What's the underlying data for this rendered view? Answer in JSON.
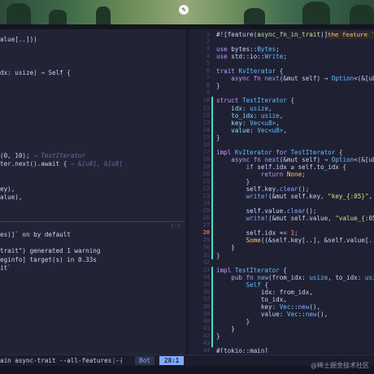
{
  "window": {
    "edit_icon": "pencil-icon"
  },
  "left_pane": {
    "code_lines": [
      {
        "text": "alue[..]))",
        "class": "v"
      },
      {
        "text": "",
        "class": "v"
      },
      {
        "text": "",
        "class": "v"
      },
      {
        "text": "",
        "class": "v"
      },
      {
        "text": "dx: usize) → Self {",
        "class": "v"
      },
      {
        "text": "",
        "class": "v"
      },
      {
        "text": "",
        "class": "v"
      },
      {
        "text": "",
        "class": "v"
      },
      {
        "text": "",
        "class": "v"
      },
      {
        "text": "",
        "class": "v"
      },
      {
        "text": "",
        "class": "v"
      },
      {
        "text": "",
        "class": "v"
      },
      {
        "text": "",
        "class": "v"
      },
      {
        "text": "",
        "class": "v"
      },
      {
        "text": "(0, 10); ",
        "class": "v",
        "hint": "⇒ TestIterator"
      },
      {
        "text": "ter.next().await { ",
        "class": "v",
        "hint": "⇒ &[u8], &[u8]"
      },
      {
        "text": "",
        "class": "v"
      },
      {
        "text": "",
        "class": "v"
      },
      {
        "text": "ey),",
        "class": "v"
      },
      {
        "text": "alue),",
        "class": "v"
      }
    ],
    "terminal_lines": [
      "es)]` on by default",
      "",
      "trait\") generated 1 warning",
      "eginfo] target(s) in 0.33s",
      "it`"
    ],
    "terminal_position": "5:5"
  },
  "right_pane": {
    "inline_hint": "the feature `a",
    "lines": [
      {
        "n": "1",
        "segs": [
          [
            "#![feature(",
            "v"
          ],
          [
            "async_fn_in_trait",
            "s"
          ],
          [
            ")]",
            "v"
          ]
        ]
      },
      {
        "n": "2",
        "segs": []
      },
      {
        "n": "3",
        "segs": [
          [
            "use ",
            "k"
          ],
          [
            "bytes::",
            "v"
          ],
          [
            "Bytes",
            "t"
          ],
          [
            ";",
            "v"
          ]
        ]
      },
      {
        "n": "4",
        "segs": [
          [
            "use ",
            "k"
          ],
          [
            "std::io::",
            "v"
          ],
          [
            "Write",
            "t"
          ],
          [
            ";",
            "v"
          ]
        ]
      },
      {
        "n": "5",
        "segs": []
      },
      {
        "n": "6",
        "segs": [
          [
            "trait ",
            "k"
          ],
          [
            "KvIterator",
            "t"
          ],
          [
            " {",
            "v"
          ]
        ]
      },
      {
        "n": "7",
        "segs": [
          [
            "    async fn ",
            "k"
          ],
          [
            "next",
            "f"
          ],
          [
            "(&mut self) → ",
            "v"
          ],
          [
            "Option",
            "t"
          ],
          [
            "<(&[u8], &[u8",
            "v"
          ]
        ]
      },
      {
        "n": "8",
        "segs": [
          [
            "}",
            "v"
          ]
        ]
      },
      {
        "n": "9",
        "segs": []
      },
      {
        "n": "10",
        "segs": [
          [
            "struct ",
            "k"
          ],
          [
            "TestIterator",
            "t"
          ],
          [
            " {",
            "v"
          ]
        ]
      },
      {
        "n": "11",
        "segs": [
          [
            "    idx",
            "p"
          ],
          [
            ": ",
            "v"
          ],
          [
            "usize",
            "t"
          ],
          [
            ",",
            "v"
          ]
        ]
      },
      {
        "n": "12",
        "segs": [
          [
            "    to_idx",
            "p"
          ],
          [
            ": ",
            "v"
          ],
          [
            "usize",
            "t"
          ],
          [
            ",",
            "v"
          ]
        ]
      },
      {
        "n": "13",
        "segs": [
          [
            "    key",
            "p"
          ],
          [
            ": ",
            "v"
          ],
          [
            "Vec<u8>",
            "t"
          ],
          [
            ",",
            "v"
          ]
        ]
      },
      {
        "n": "14",
        "segs": [
          [
            "    value",
            "p"
          ],
          [
            ": ",
            "v"
          ],
          [
            "Vec<u8>",
            "t"
          ],
          [
            ",",
            "v"
          ]
        ]
      },
      {
        "n": "15",
        "segs": [
          [
            "}",
            "v"
          ]
        ]
      },
      {
        "n": "16",
        "segs": []
      },
      {
        "n": "17",
        "segs": [
          [
            "impl ",
            "k"
          ],
          [
            "KvIterator",
            "t"
          ],
          [
            " for ",
            "k"
          ],
          [
            "TestIterator",
            "t"
          ],
          [
            " {",
            "v"
          ]
        ]
      },
      {
        "n": "18",
        "segs": [
          [
            "    async fn ",
            "k"
          ],
          [
            "next",
            "f"
          ],
          [
            "(&mut self) → ",
            "v"
          ],
          [
            "Option",
            "t"
          ],
          [
            "<(&[u8], &[u8",
            "v"
          ]
        ]
      },
      {
        "n": "19",
        "segs": [
          [
            "        if ",
            "k"
          ],
          [
            "self.idx ≥ self.to_idx {",
            "v"
          ]
        ]
      },
      {
        "n": "20",
        "segs": [
          [
            "            return ",
            "k"
          ],
          [
            "None",
            "y"
          ],
          [
            ";",
            "v"
          ]
        ]
      },
      {
        "n": "21",
        "segs": [
          [
            "        }",
            "v"
          ]
        ]
      },
      {
        "n": "22",
        "segs": [
          [
            "        self.key.",
            "v"
          ],
          [
            "clear",
            "f"
          ],
          [
            "();",
            "v"
          ]
        ]
      },
      {
        "n": "23",
        "segs": [
          [
            "        write!",
            "f"
          ],
          [
            "(&mut self.key, ",
            "v"
          ],
          [
            "\"key_{:05}\"",
            "s"
          ],
          [
            ", self.idx",
            "v"
          ]
        ]
      },
      {
        "n": "24",
        "segs": []
      },
      {
        "n": "25",
        "segs": [
          [
            "        self.value.",
            "v"
          ],
          [
            "clear",
            "f"
          ],
          [
            "();",
            "v"
          ]
        ]
      },
      {
        "n": "26",
        "segs": [
          [
            "        write!",
            "f"
          ],
          [
            "(&mut self.value, ",
            "v"
          ],
          [
            "\"value_{:05}\"",
            "s"
          ],
          [
            ", self",
            "v"
          ]
        ]
      },
      {
        "n": "27",
        "segs": []
      },
      {
        "n": "28",
        "segs": [
          [
            "        self.idx += ",
            "v"
          ],
          [
            "1",
            "n"
          ],
          [
            ";",
            "v"
          ]
        ]
      },
      {
        "n": "29",
        "segs": [
          [
            "        Some",
            "y"
          ],
          [
            "((&self.key[..], &self.value[..]))",
            "v"
          ]
        ]
      },
      {
        "n": "30",
        "segs": [
          [
            "    }",
            "v"
          ]
        ]
      },
      {
        "n": "31",
        "segs": [
          [
            "}",
            "v"
          ]
        ]
      },
      {
        "n": "32",
        "segs": []
      },
      {
        "n": "33",
        "segs": [
          [
            "impl ",
            "k"
          ],
          [
            "TestIterator",
            "t"
          ],
          [
            " {",
            "v"
          ]
        ]
      },
      {
        "n": "34",
        "segs": [
          [
            "    pub fn ",
            "k"
          ],
          [
            "new",
            "f"
          ],
          [
            "(from_idx: ",
            "v"
          ],
          [
            "usize",
            "t"
          ],
          [
            ", to_idx: ",
            "v"
          ],
          [
            "usize",
            "t"
          ],
          [
            ") → ",
            "v"
          ],
          [
            "S",
            "t"
          ]
        ]
      },
      {
        "n": "35",
        "segs": [
          [
            "        Self",
            "t"
          ],
          [
            " {",
            "v"
          ]
        ]
      },
      {
        "n": "36",
        "segs": [
          [
            "            idx: from_idx,",
            "v"
          ]
        ]
      },
      {
        "n": "37",
        "segs": [
          [
            "            to_idx,",
            "v"
          ]
        ]
      },
      {
        "n": "38",
        "segs": [
          [
            "            key: ",
            "v"
          ],
          [
            "Vec",
            "t"
          ],
          [
            "::",
            "v"
          ],
          [
            "new",
            "f"
          ],
          [
            "(),",
            "v"
          ]
        ]
      },
      {
        "n": "39",
        "segs": [
          [
            "            value: ",
            "v"
          ],
          [
            "Vec",
            "t"
          ],
          [
            "::",
            "v"
          ],
          [
            "new",
            "f"
          ],
          [
            "(),",
            "v"
          ]
        ]
      },
      {
        "n": "40",
        "segs": [
          [
            "        }",
            "v"
          ]
        ]
      },
      {
        "n": "41",
        "segs": [
          [
            "    }",
            "v"
          ]
        ]
      },
      {
        "n": "42",
        "segs": [
          [
            "}",
            "v"
          ]
        ]
      },
      {
        "n": "43",
        "segs": []
      },
      {
        "n": "44",
        "segs": [
          [
            "#[tokio::main]",
            "v"
          ]
        ]
      }
    ]
  },
  "status_bar": {
    "command": "ain async-trait --all-features --",
    "bracket_button": "[-]",
    "mode": "Bot",
    "cursor_position": "28:1"
  },
  "watermark": "@稀土掘金技术社区"
}
